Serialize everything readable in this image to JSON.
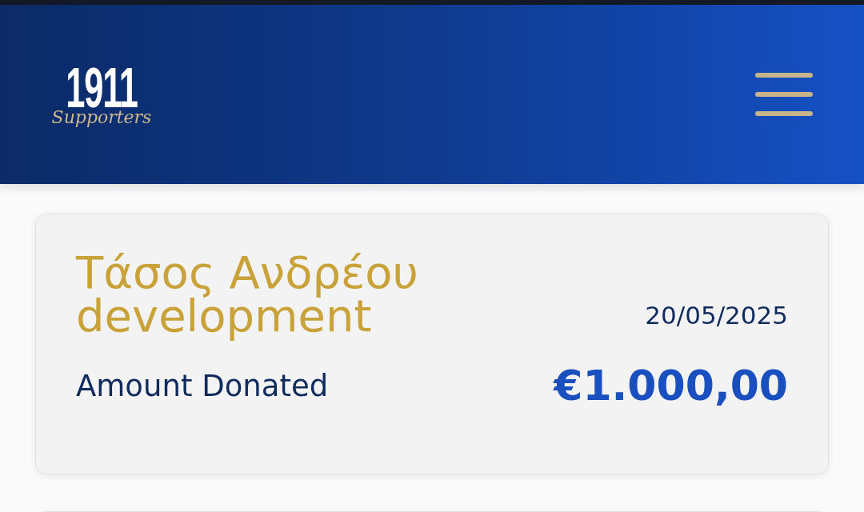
{
  "header": {
    "logo": {
      "number": "1911",
      "script": "Supporters"
    }
  },
  "donations": [
    {
      "title": "Τάσος Ανδρέου development",
      "date": "20/05/2025",
      "amount_label": "Amount Donated",
      "amount": "€1.000,00"
    }
  ]
}
